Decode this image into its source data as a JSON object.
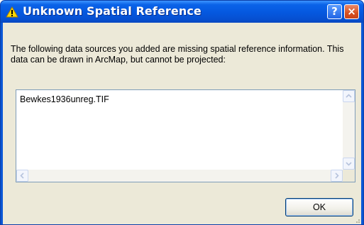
{
  "dialog": {
    "title": "Unknown Spatial Reference",
    "help_label": "?",
    "close_label": "×",
    "message": "The following data sources you added are missing spatial reference information. This data can be drawn in ArcMap, but cannot be projected:",
    "sources": [
      "Bewkes1936unreg.TIF"
    ],
    "ok_label": "OK"
  },
  "colors": {
    "titlebar": "#0558df",
    "client_bg": "#ece9d8",
    "close_button": "#d7501f"
  },
  "icons": {
    "title": "warning-icon",
    "scroll_up": "arrow-up-icon",
    "scroll_down": "arrow-down-icon",
    "scroll_left": "arrow-left-icon",
    "scroll_right": "arrow-right-icon"
  }
}
